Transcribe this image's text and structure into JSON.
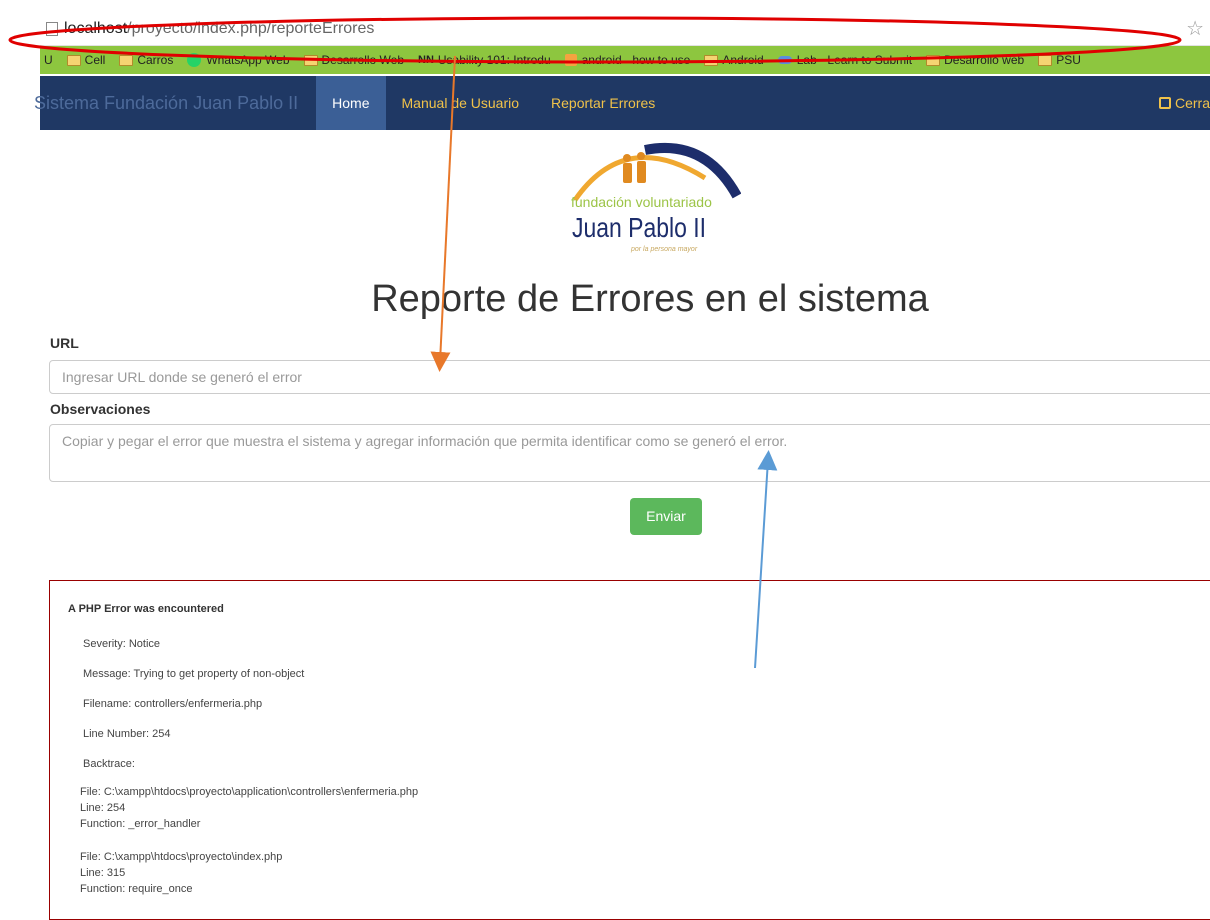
{
  "browser": {
    "url_host": "localhost",
    "url_path": "/proyecto/index.php/reporteErrores",
    "bookmarks": [
      {
        "label": "U",
        "icon": "none"
      },
      {
        "label": "Cell",
        "icon": "folder-icon"
      },
      {
        "label": "Carros",
        "icon": "folder-icon"
      },
      {
        "label": "WhatsApp Web",
        "icon": "whatsapp-icon"
      },
      {
        "label": "Desarrollo Web",
        "icon": "folder-icon"
      },
      {
        "label": "Usability 101: Introdu",
        "icon": "nn-icon"
      },
      {
        "label": "android - how to use",
        "icon": "stackoverflow-icon"
      },
      {
        "label": "Android",
        "icon": "folder-icon"
      },
      {
        "label": "Lab - Learn to Submit",
        "icon": "lab-icon"
      },
      {
        "label": "Desarrollo web",
        "icon": "folder-icon"
      },
      {
        "label": "PSU",
        "icon": "folder-icon"
      }
    ]
  },
  "navbar": {
    "brand": "Sistema Fundación Juan Pablo II",
    "items": [
      "Home",
      "Manual de Usuario",
      "Reportar Errores"
    ],
    "logout": "Cerra"
  },
  "logo": {
    "line1": "fundación voluntariado",
    "line2": "Juan Pablo II",
    "line3": "por la persona mayor"
  },
  "page": {
    "title": "Reporte de Errores en el sistema",
    "url_label": "URL",
    "url_placeholder": "Ingresar URL donde se generó el error",
    "obs_label": "Observaciones",
    "obs_placeholder": "Copiar y pegar el error que muestra el sistema y agregar información que permita identificar como se generó el error.",
    "submit": "Enviar"
  },
  "error": {
    "heading": "A PHP Error was encountered",
    "severity": "Severity: Notice",
    "message": "Message: Trying to get property of non-object",
    "filename": "Filename: controllers/enfermeria.php",
    "line_number": "Line Number: 254",
    "backtrace": "Backtrace:",
    "trace": [
      {
        "file": "File: C:\\xampp\\htdocs\\proyecto\\application\\controllers\\enfermeria.php",
        "line": "Line: 254",
        "function": "Function: _error_handler"
      },
      {
        "file": "File: C:\\xampp\\htdocs\\proyecto\\index.php",
        "line": "Line: 315",
        "function": "Function: require_once"
      }
    ]
  },
  "colors": {
    "navbar": "#1f3864",
    "nav_link": "#f0c24a",
    "bookmark_bar": "#8dc63f",
    "submit": "#5cb85c",
    "annotation_ellipse": "#e00000",
    "annotation_orange": "#e8782a",
    "annotation_blue": "#5b9bd5"
  }
}
